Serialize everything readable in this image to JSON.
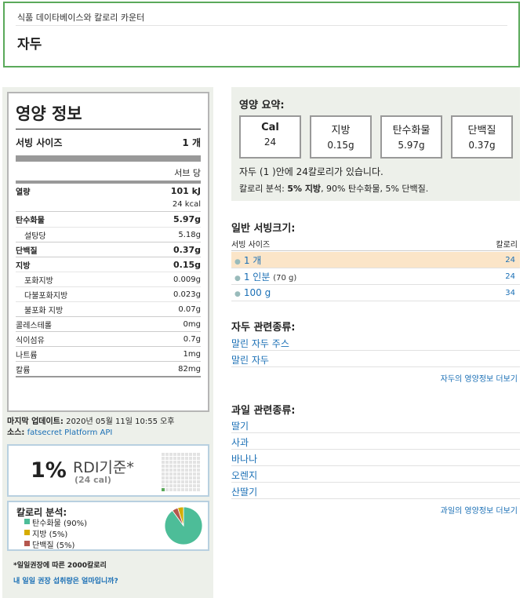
{
  "header": {
    "crumb": "식품 데이타베이스와 칼로리 카운터",
    "title": "자두"
  },
  "nutrition": {
    "title": "영양 정보",
    "serving_label": "서빙 사이즈",
    "serving_value": "1 개",
    "per_label": "서브 당",
    "energy_label": "열량",
    "energy_kj": "101 kJ",
    "energy_kcal": "24 kcal",
    "rows": [
      {
        "label": "탄수화물",
        "value": "5.97g"
      },
      {
        "label": "설탕당",
        "value": "5.18g"
      },
      {
        "label": "단백질",
        "value": "0.37g"
      },
      {
        "label": "지방",
        "value": "0.15g"
      },
      {
        "label": "포화지방",
        "value": "0.009g"
      },
      {
        "label": "다불포화지방",
        "value": "0.023g"
      },
      {
        "label": "불포화 지방",
        "value": "0.07g"
      },
      {
        "label": "콜레스테롤",
        "value": "0mg"
      },
      {
        "label": "식이섬유",
        "value": "0.7g"
      },
      {
        "label": "나트륨",
        "value": "1mg"
      },
      {
        "label": "칼륨",
        "value": "82mg"
      }
    ]
  },
  "meta": {
    "updated_label": "마지막 업데이트:",
    "updated_value": "2020년 05월 11일 10:55 오후",
    "source_label": "소스:",
    "source_link": "fatsecret Platform API"
  },
  "rdi": {
    "percent": "1%",
    "label": "RDI기준*",
    "kcal": "(24 cal)",
    "fill_fraction": 0.01,
    "note": "*일일권장에 따른 2000칼로리",
    "link": "내 일일 권장 섭취량은 얼마입니까?"
  },
  "breakdown": {
    "title": "칼로리 분석:",
    "items": [
      {
        "label": "탄수화물 (90%)",
        "percent": 90,
        "color": "#4dbd98"
      },
      {
        "label": "지방 (5%)",
        "percent": 5,
        "color": "#d6ac00"
      },
      {
        "label": "단백질 (5%)",
        "percent": 5,
        "color": "#b5574e"
      }
    ]
  },
  "summary": {
    "title": "영양 요약:",
    "boxes": [
      {
        "label": "Cal",
        "value": "24"
      },
      {
        "label": "지방",
        "value": "0.15g"
      },
      {
        "label": "탄수화물",
        "value": "5.97g"
      },
      {
        "label": "단백질",
        "value": "0.37g"
      }
    ],
    "line1": "자두 (1 )안에 24칼로리가 있습니다.",
    "line2_prefix": "칼로리 분석: ",
    "line2_bold": "5% 지방",
    "line2_rest": ", 90% 탄수화물, 5% 단백질."
  },
  "servings": {
    "title": "일반 서빙크기:",
    "col_size": "서빙 사이즈",
    "col_cal": "칼로리",
    "rows": [
      {
        "label": "1 개",
        "extra": "",
        "cal": "24"
      },
      {
        "label": "1 인분",
        "extra": "(70 g)",
        "cal": "24"
      },
      {
        "label": "100 g",
        "extra": "",
        "cal": "34"
      }
    ]
  },
  "related_plum": {
    "title": "자두 관련종류:",
    "items": [
      "말린 자두 주스",
      "말린 자두"
    ],
    "more": "자두의 영양정보 더보기"
  },
  "related_fruit": {
    "title": "과일 관련종류:",
    "items": [
      "딸기",
      "사과",
      "바나나",
      "오렌지",
      "산딸기"
    ],
    "more": "과일의 영양정보 더보기"
  }
}
